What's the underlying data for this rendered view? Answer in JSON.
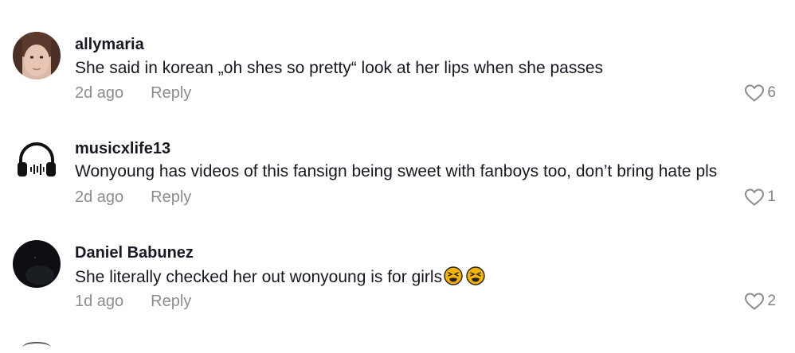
{
  "comments": [
    {
      "username": "allymaria",
      "text": "She said in korean „oh shes so pretty“ look at her lips when she passes",
      "time": "2d ago",
      "reply_label": "Reply",
      "likes": "6",
      "avatar_icon": "profile-photo"
    },
    {
      "username": "musicxlife13",
      "text": "Wonyoung has videos of this fansign being sweet with fanboys too, don’t bring hate pls",
      "time": "2d ago",
      "reply_label": "Reply",
      "likes": "1",
      "avatar_icon": "headphones-icon"
    },
    {
      "username": "Daniel Babunez",
      "text": "She literally checked her out wonyoung is for girls",
      "text_emojis": [
        "tired-face-emoji",
        "tired-face-emoji"
      ],
      "time": "1d ago",
      "reply_label": "Reply",
      "likes": "2",
      "avatar_icon": "profile-photo-dark"
    }
  ],
  "colors": {
    "text_primary": "#161823",
    "text_secondary": "#8a8b91",
    "emoji_yellow": "#f4b400"
  }
}
